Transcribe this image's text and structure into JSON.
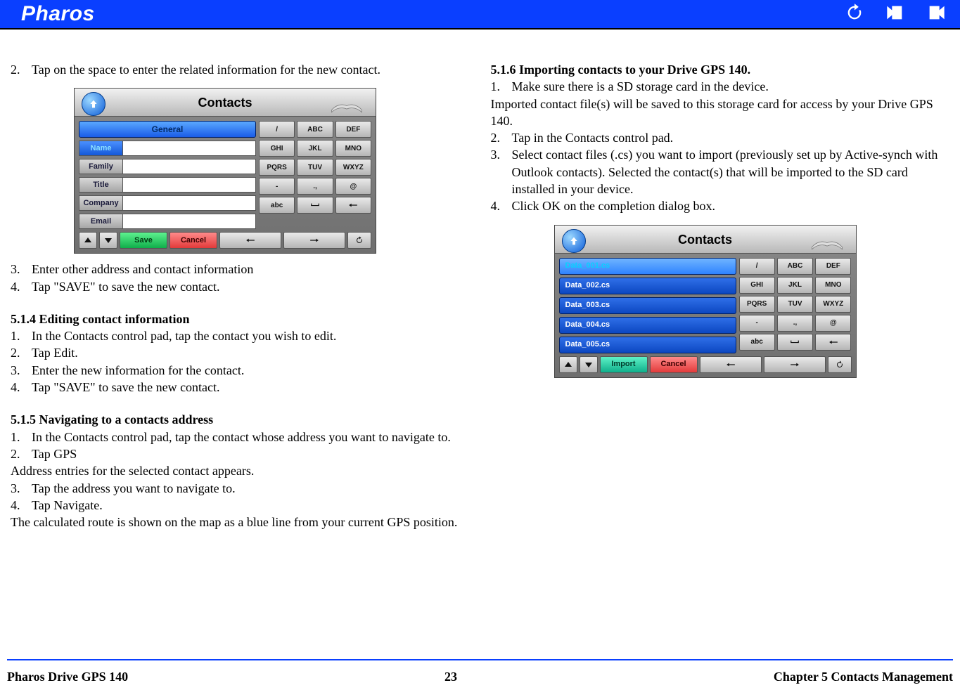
{
  "header": {
    "brand": "Pharos"
  },
  "left": {
    "step2": {
      "n": "2.",
      "t": "Tap on the space to enter the related information for the new contact."
    },
    "fig1": {
      "title": "Contacts",
      "tab": "General",
      "fields": [
        "Name",
        "Family",
        "Title",
        "Company",
        "Email"
      ],
      "save": "Save",
      "cancel": "Cancel"
    },
    "keypad": [
      "/",
      "ABC",
      "DEF",
      "GHI",
      "JKL",
      "MNO",
      "PQRS",
      "TUV",
      "WXYZ",
      "-",
      ".,",
      "@",
      "abc",
      "␣",
      "←"
    ],
    "step3": {
      "n": "3.",
      "t": "Enter other address and contact information"
    },
    "step4": {
      "n": "4.",
      "t": "Tap \"SAVE\" to save the new contact."
    },
    "s514": {
      "title": "5.1.4    Editing contact information",
      "l1n": "1.",
      "l1t": "In the Contacts control pad, tap the contact you wish to edit.",
      "l2n": "2.",
      "l2t": "Tap Edit.",
      "l3n": "3.",
      "l3t": "Enter the new information for the contact.",
      "l4n": "4.",
      "l4t": "Tap \"SAVE\" to save the new contact."
    },
    "s515": {
      "title": "5.1.5    Navigating to a contacts address",
      "l1n": "1.",
      "l1t": "In the Contacts control pad, tap the contact whose address you want to navigate to.",
      "l2n": "2.",
      "l2t": "Tap GPS",
      "p1": "Address entries for the selected contact appears.",
      "l3n": "3.",
      "l3t": "Tap the address you want to navigate to.",
      "l4n": "4.",
      "l4t": "Tap Navigate.",
      "p2": "The calculated route is shown on the map as a blue line from your current GPS position."
    }
  },
  "right": {
    "s516": {
      "title": "5.1.6    Importing contacts to your Drive GPS 140.",
      "l1n": "1.",
      "l1t": "Make sure there is a SD storage card in the device.",
      "p1": "Imported contact file(s) will be saved to this storage card for access by your Drive GPS 140.",
      "l2n": "2.",
      "l2t": "Tap in the Contacts control pad.",
      "l3n": "3.",
      "l3t": "Select contact files (.cs) you want to import (previously set up by Active-synch with Outlook contacts). Selected the contact(s) that will be imported to the SD card installed in your device.",
      "l4n": "4.",
      "l4t": "Click OK on the completion dialog box."
    },
    "fig2": {
      "title": "Contacts",
      "files": [
        "Data_001.cs",
        "Data_002.cs",
        "Data_003.cs",
        "Data_004.cs",
        "Data_005.cs"
      ],
      "import": "Import",
      "cancel": "Cancel"
    }
  },
  "footer": {
    "left": "Pharos Drive GPS 140",
    "center": "23",
    "right": "Chapter 5 Contacts Management"
  }
}
